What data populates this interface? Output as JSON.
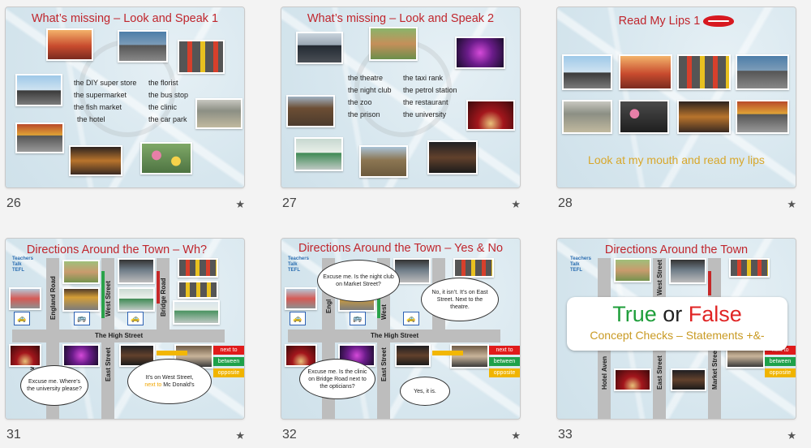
{
  "colors": {
    "title_red": "#c0262d",
    "gold": "#d8a72b",
    "true_green": "#1e9e3a",
    "false_red": "#e02525",
    "tag_red": "#e01b1b",
    "tag_green": "#1ea14a",
    "tag_yellow": "#f0b400"
  },
  "slides": [
    {
      "number": "26",
      "title": "What’s missing – Look and Speak 1",
      "words_left": [
        "the DIY super store",
        "the supermarket",
        "the fish market",
        "the hotel"
      ],
      "words_right": [
        "the florist",
        "the bus stop",
        "the clinic",
        "the car park"
      ]
    },
    {
      "number": "27",
      "title": "What’s missing – Look and Speak 2",
      "words_left": [
        "the theatre",
        "the night club",
        "the zoo",
        "the prison"
      ],
      "words_right": [
        "the taxi rank",
        "the petrol station",
        "the restaurant",
        "the university"
      ]
    },
    {
      "number": "28",
      "title": "Read My Lips 1",
      "subtitle": "Look at my mouth and read my lips"
    },
    {
      "number": "31",
      "title": "Directions Around the Town – Wh?",
      "logo": "Teachers Talk TEFL",
      "roads": {
        "england": "England Road",
        "west": "West Street",
        "bridge": "Bridge Road",
        "high": "The High Street",
        "avenue": "venue",
        "east": "East Street"
      },
      "bubble_1": "Excuse me. Where’s the university please?",
      "bubble_2_a": "It’s on West Street,",
      "bubble_2_b": "next to",
      "bubble_2_c": " Mc Donald’s",
      "tags": [
        "next to",
        "between",
        "opposite"
      ]
    },
    {
      "number": "32",
      "title": "Directions Around the Town – Yes & No",
      "logo": "Teachers Talk TEFL",
      "roads": {
        "england": "Engl",
        "west": "West",
        "high": "The High Street",
        "avenue": "enue",
        "east": "East Street"
      },
      "bubble_1": "Excuse me. Is the night club on Market Street?",
      "bubble_2": "No, it isn’t. It’s on East Street. Next to the theatre.",
      "bubble_3": "Excuse me. Is the clinic on Bridge Road next to the opticians?",
      "bubble_4": "Yes, it is.",
      "tags": [
        "next to",
        "between",
        "opposite"
      ]
    },
    {
      "number": "33",
      "title": "Directions Around the Town",
      "logo": "Teachers Talk TEFL",
      "roads": {
        "west": "West Street",
        "avenue": "Hotel Aven",
        "east": "East Street",
        "market": "Market Street"
      },
      "tf_true": "True",
      "tf_or": " or ",
      "tf_false": "False",
      "tf_sub": "Concept Checks – Statements +&-",
      "tags": [
        "next to",
        "between",
        "opposite"
      ]
    }
  ],
  "star_glyph": "★"
}
